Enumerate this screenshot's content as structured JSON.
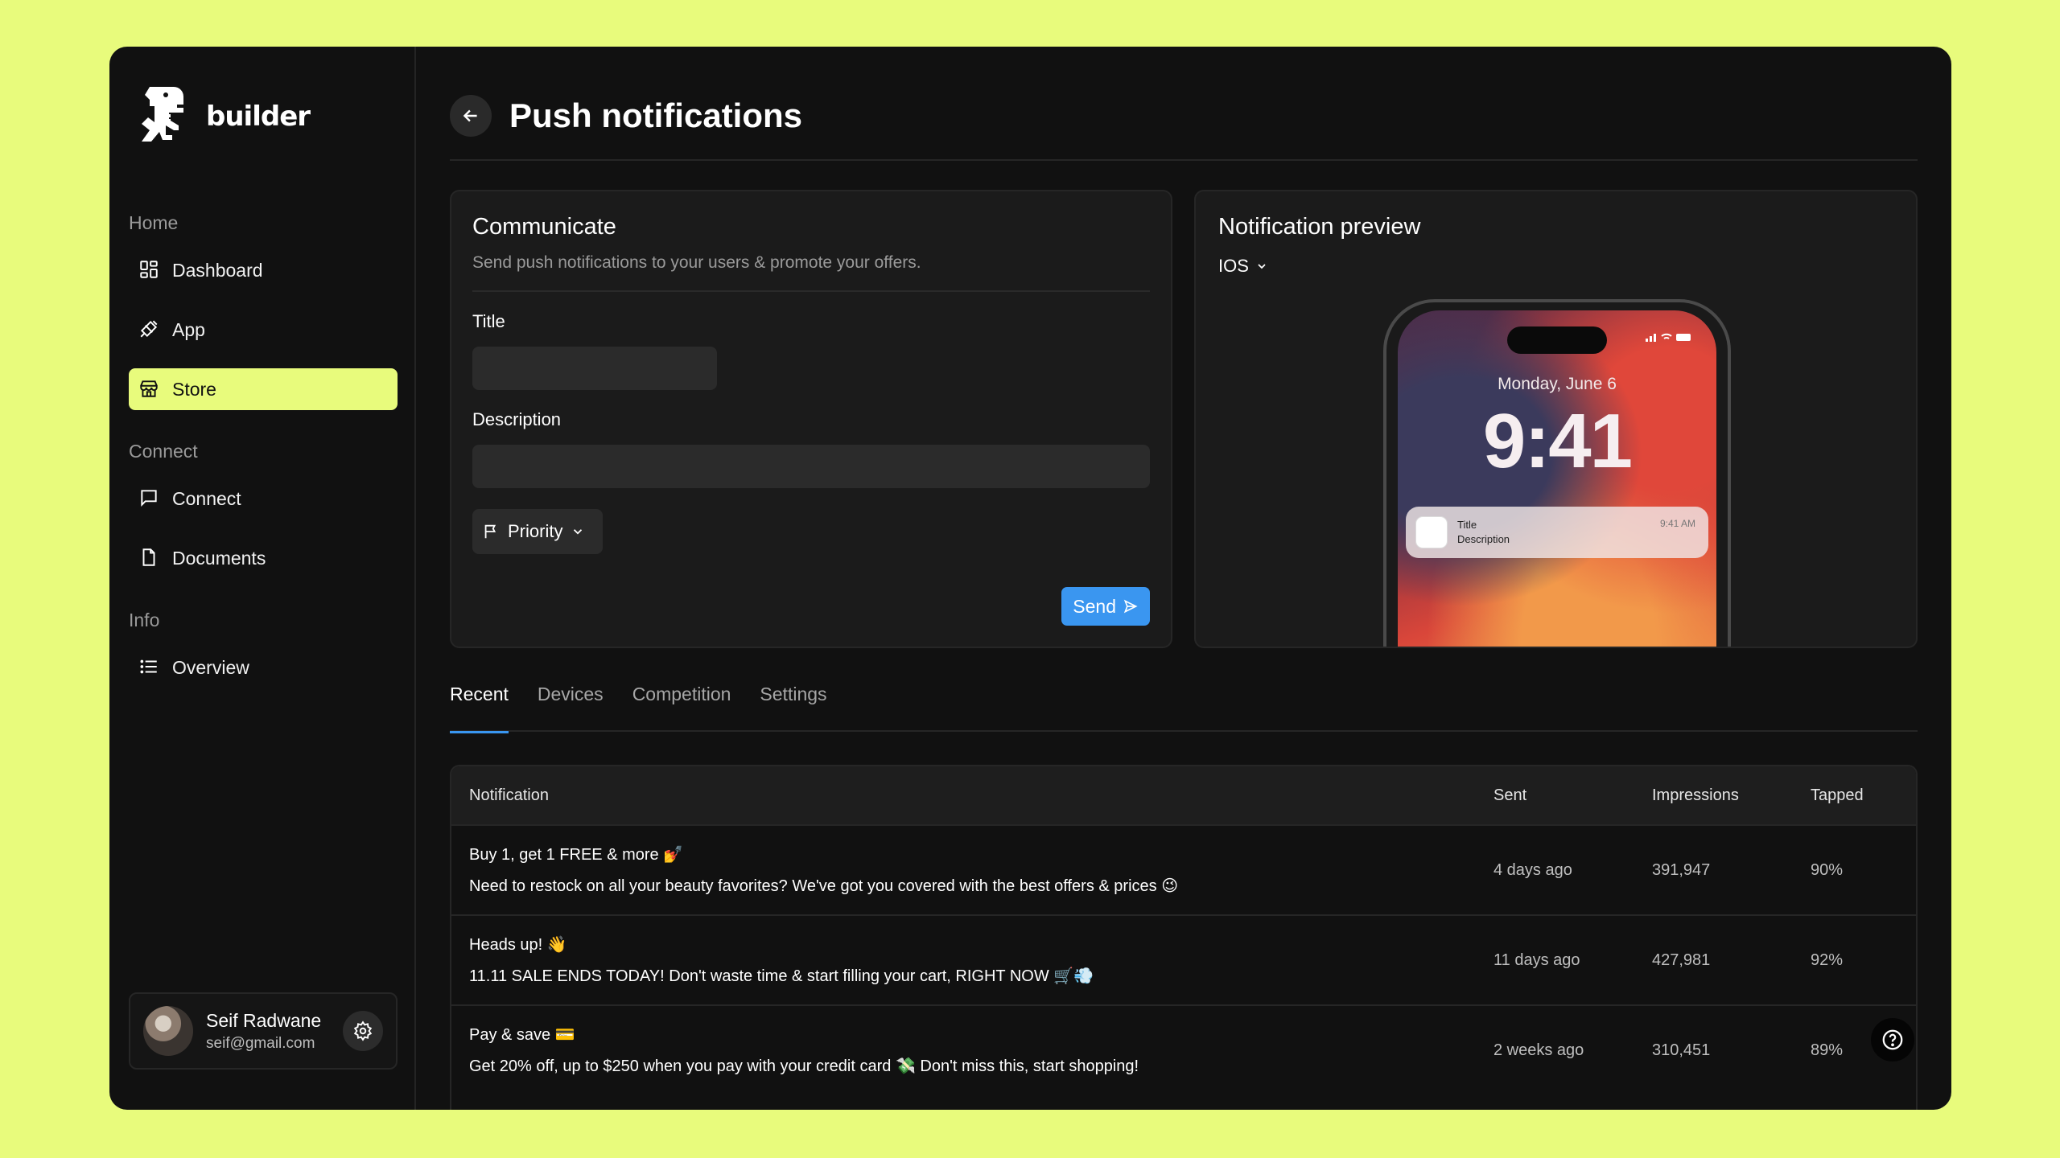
{
  "brand": {
    "name": "builder",
    "logo_icon": "dino-logo-icon"
  },
  "sidebar": {
    "sections": [
      {
        "label": "Home"
      },
      {
        "label": "Connect"
      },
      {
        "label": "Info"
      }
    ],
    "items": [
      {
        "label": "Dashboard",
        "icon": "dashboard-icon"
      },
      {
        "label": "App",
        "icon": "app-icon"
      },
      {
        "label": "Store",
        "icon": "store-icon",
        "active": true
      },
      {
        "label": "Connect",
        "icon": "chat-icon"
      },
      {
        "label": "Documents",
        "icon": "document-icon"
      },
      {
        "label": "Overview",
        "icon": "list-icon"
      }
    ]
  },
  "user": {
    "name": "Seif Radwane",
    "email": "seif@gmail.com"
  },
  "header": {
    "title": "Push notifications"
  },
  "communicate": {
    "title": "Communicate",
    "subtitle": "Send push notifications to your users & promote your offers.",
    "title_label": "Title",
    "title_value": "",
    "description_label": "Description",
    "description_value": "",
    "priority_label": "Priority",
    "send_label": "Send"
  },
  "preview": {
    "title": "Notification preview",
    "os": "IOS",
    "lock_date": "Monday, June 6",
    "lock_time": "9:41",
    "notif_title": "Title",
    "notif_description": "Description",
    "notif_time": "9:41 AM"
  },
  "tabs": [
    "Recent",
    "Devices",
    "Competition",
    "Settings"
  ],
  "table": {
    "headers": [
      "Notification",
      "Sent",
      "Impressions",
      "Tapped"
    ],
    "rows": [
      {
        "title": "Buy 1, get 1 FREE & more 💅",
        "body": "Need to restock on all your beauty favorites? We've got you covered with the best offers & prices 😉",
        "sent": "4 days ago",
        "impressions": "391,947",
        "tapped": "90%"
      },
      {
        "title": "Heads up! 👋",
        "body": "11.11 SALE ENDS TODAY! Don't waste time & start filling your cart, RIGHT NOW 🛒💨",
        "sent": "11 days ago",
        "impressions": "427,981",
        "tapped": "92%"
      },
      {
        "title": "Pay & save 💳",
        "body": "Get 20% off, up to $250 when you pay with your credit card 💸 Don't miss this, start shopping!",
        "sent": "2 weeks ago",
        "impressions": "310,451",
        "tapped": "89%"
      }
    ]
  },
  "colors": {
    "accent": "#e8fb7c",
    "primary_button": "#3a96f0",
    "background": "#111111"
  }
}
